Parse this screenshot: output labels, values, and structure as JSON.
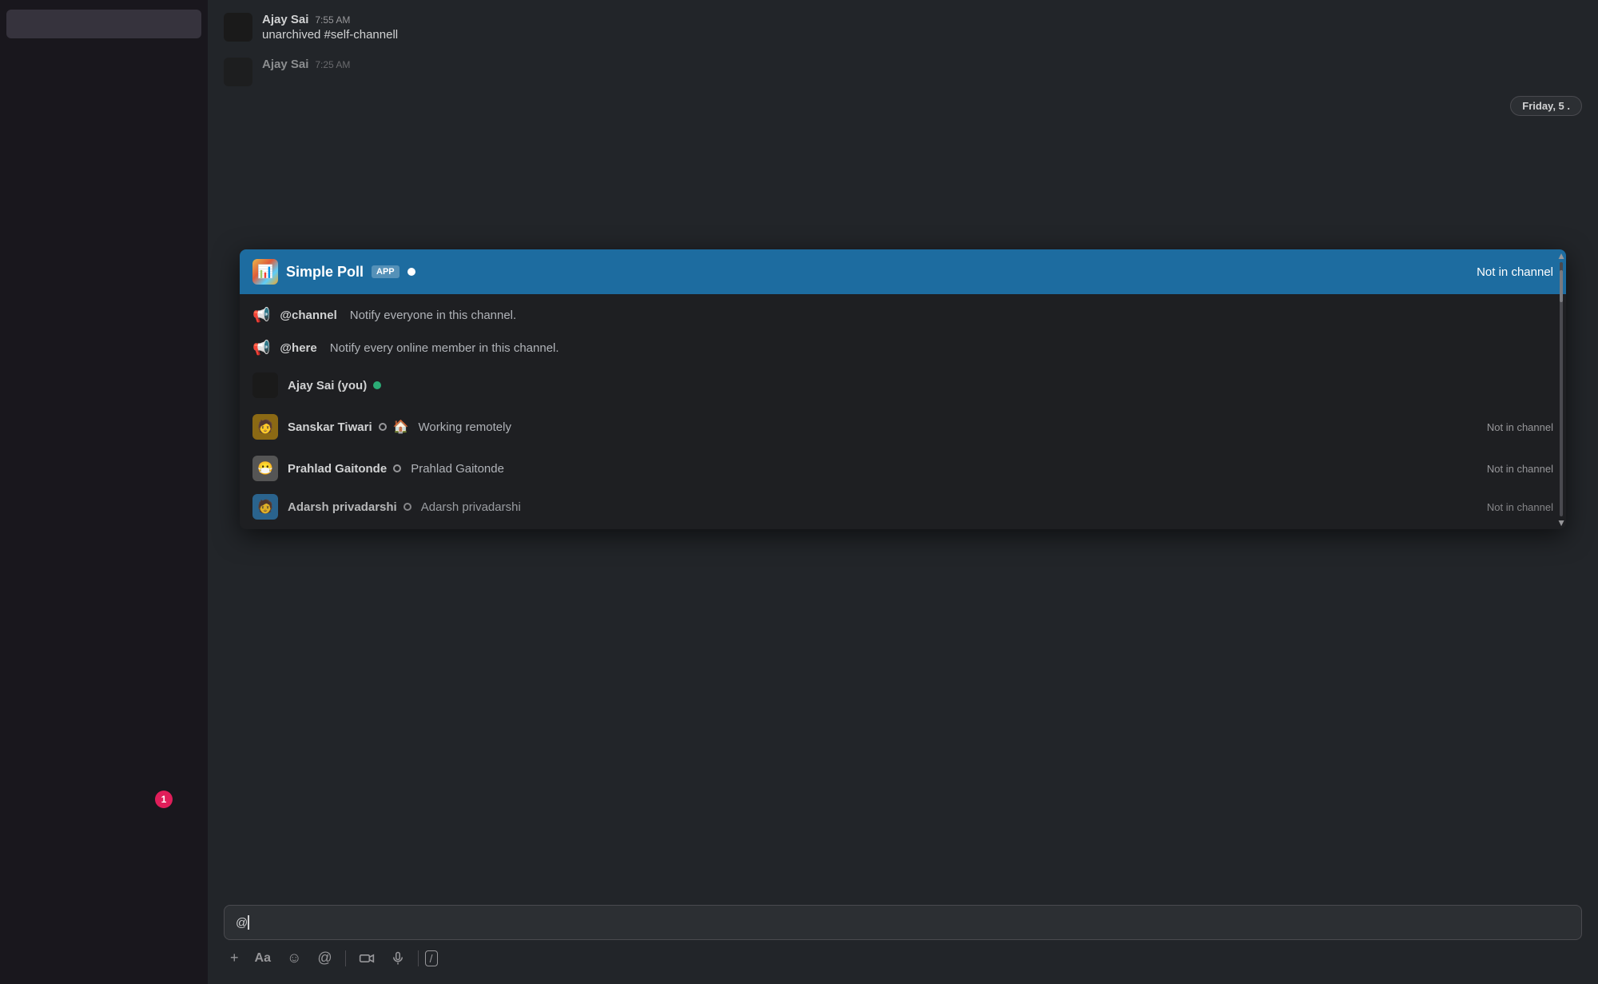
{
  "sidebar": {
    "notification_count": "1"
  },
  "chat": {
    "messages": [
      {
        "id": "msg1",
        "sender": "Ajay Sai",
        "time": "7:55 AM",
        "text": "unarchived #self-channell"
      },
      {
        "id": "msg2",
        "sender": "Ajay Sai",
        "time": "7:25 AM",
        "text": ""
      }
    ],
    "date_label": "Friday, 5 ."
  },
  "dropdown": {
    "header": {
      "app_name": "Simple Poll",
      "app_badge": "APP",
      "not_in_channel": "Not in channel"
    },
    "items": [
      {
        "type": "channel",
        "name": "@channel",
        "description": "Notify everyone in this channel.",
        "id": "channel"
      },
      {
        "type": "here",
        "name": "@here",
        "description": "Notify every online member in this channel.",
        "id": "here"
      },
      {
        "type": "user",
        "name": "Ajay Sai (you)",
        "status": "online",
        "status_text": "",
        "not_in_channel": "",
        "id": "ajay"
      },
      {
        "type": "user",
        "name": "Sanskar Tiwari",
        "status": "away",
        "status_emoji": "🏠",
        "status_text": "Working remotely",
        "not_in_channel": "Not in channel",
        "id": "sanskar"
      },
      {
        "type": "user",
        "name": "Prahlad Gaitonde",
        "status": "away",
        "status_text": "Prahlad Gaitonde",
        "not_in_channel": "Not in channel",
        "id": "prahlad"
      },
      {
        "type": "user",
        "name": "Adarsh privadarshi",
        "status": "away",
        "status_text": "Adarsh privadarshi",
        "not_in_channel": "Not in channel",
        "id": "adarsh"
      }
    ]
  },
  "input": {
    "text": "@",
    "placeholder": ""
  },
  "toolbar": {
    "buttons": [
      "+",
      "Aa",
      "☺",
      "@",
      "🎥",
      "🎤",
      "/"
    ]
  }
}
